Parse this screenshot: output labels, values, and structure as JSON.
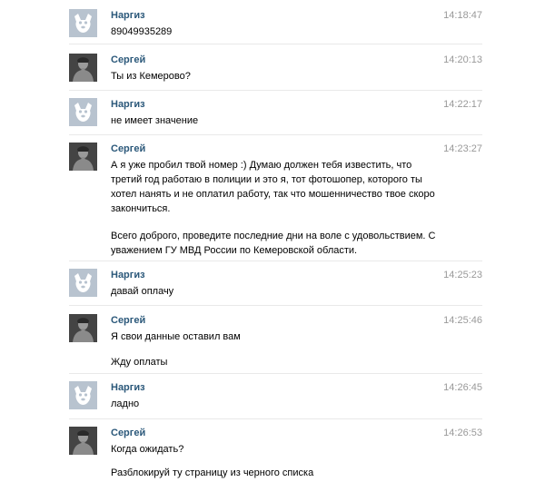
{
  "messages": [
    {
      "author": "Наргиз",
      "avatar": "vk-dog-avatar",
      "time": "14:18:47",
      "paragraphs": [
        "89049935289"
      ]
    },
    {
      "author": "Сергей",
      "avatar": "user-photo-avatar",
      "time": "14:20:13",
      "paragraphs": [
        "Ты из Кемерово?"
      ]
    },
    {
      "author": "Наргиз",
      "avatar": "vk-dog-avatar",
      "time": "14:22:17",
      "paragraphs": [
        "не имеет значение"
      ]
    },
    {
      "author": "Сергей",
      "avatar": "user-photo-avatar",
      "time": "14:23:27",
      "paragraphs": [
        "А я уже пробил твой номер :) Думаю должен тебя известить, что третий год работаю в полиции и это я, тот фотошопер, которого ты хотел нанять и не оплатил работу, так что мошенничество твое скоро закончиться.",
        "Всего доброго, проведите последние дни на воле с удовольствием. С уважением ГУ МВД России по Кемеровской области."
      ]
    },
    {
      "author": "Наргиз",
      "avatar": "vk-dog-avatar",
      "time": "14:25:23",
      "paragraphs": [
        "давай оплачу"
      ]
    },
    {
      "author": "Сергей",
      "avatar": "user-photo-avatar",
      "time": "14:25:46",
      "paragraphs": [
        "Я свои данные оставил вам",
        "Жду оплаты"
      ]
    },
    {
      "author": "Наргиз",
      "avatar": "vk-dog-avatar",
      "time": "14:26:45",
      "paragraphs": [
        "ладно"
      ]
    },
    {
      "author": "Сергей",
      "avatar": "user-photo-avatar",
      "time": "14:26:53",
      "paragraphs": [
        "Когда ожидать?",
        "Разблокируй ту страницу из черного списка"
      ]
    }
  ],
  "colors": {
    "author_link": "#2b587a",
    "timestamp": "#999999",
    "dog_avatar_bg": "#b8c3cf",
    "background": "#ffffff"
  }
}
